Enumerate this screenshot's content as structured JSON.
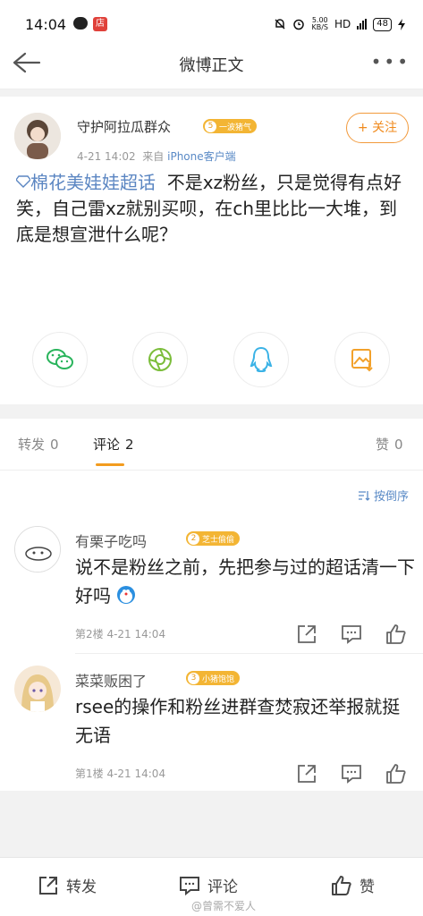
{
  "status": {
    "time": "14:04",
    "speed": "5.00\nKB/S",
    "network": "HD",
    "signal": "4G",
    "battery": "48"
  },
  "nav": {
    "title": "微博正文"
  },
  "post": {
    "author": "守护阿拉瓜群众",
    "badge_level": "5",
    "badge_text": "一波猪气",
    "time": "4-21 14:02",
    "from": "来自",
    "source": "iPhone客户端",
    "follow": "+ 关注",
    "topic": "棉花美娃娃超话",
    "body": "不是xz粉丝，只是觉得有点好笑，自己雷xz就别买呗，在ch里比比一大堆，到底是想宣泄什么呢？"
  },
  "share": [
    {
      "icon": "wechat-icon"
    },
    {
      "icon": "moments-icon"
    },
    {
      "icon": "qq-icon"
    },
    {
      "icon": "save-image-icon"
    }
  ],
  "tabs": {
    "repost": "转发",
    "repost_count": "0",
    "comment": "评论",
    "comment_count": "2",
    "like": "赞",
    "like_count": "0"
  },
  "sort_label": "按倒序",
  "comments": [
    {
      "name": "有栗子吃吗",
      "badge_level": "2",
      "badge_text": "芝士偷偷",
      "text": "说不是粉丝之前，先把参与过的超话清一下好吗",
      "meta": "第2楼  4-21 14:04"
    },
    {
      "name": "菜菜贩困了",
      "badge_level": "3",
      "badge_text": "小猪饱饱",
      "text": "rsee的操作和粉丝进群查焚寂还举报就挺无语",
      "meta": "第1楼  4-21 14:04"
    }
  ],
  "bottom": {
    "repost": "转发",
    "comment": "评论",
    "like": "赞"
  },
  "watermark": "@曾需不爱人",
  "colors": {
    "accent": "#f39c1f",
    "link": "#5a8ac6",
    "badge": "#f3b534"
  }
}
